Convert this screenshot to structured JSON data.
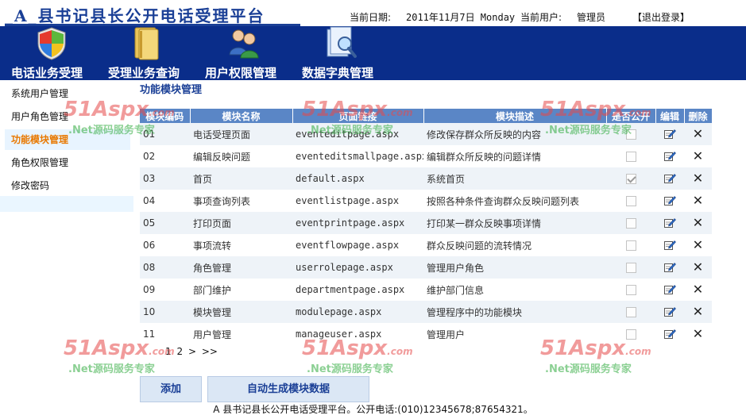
{
  "header": {
    "app_title": "_A_县书记县长公开电话受理平台",
    "date_label": "当前日期:",
    "date_value": "2011年11月7日 Monday",
    "user_label": "当前用户:",
    "user_value": "管理员",
    "logout_label": "【退出登录】"
  },
  "menu": [
    {
      "label": "电话业务受理",
      "icon": "shield-icon"
    },
    {
      "label": "受理业务查询",
      "icon": "folder-icon"
    },
    {
      "label": "用户权限管理",
      "icon": "users-icon"
    },
    {
      "label": "数据字典管理",
      "icon": "search-document-icon"
    }
  ],
  "sidebar": {
    "items": [
      {
        "label": "系统用户管理",
        "active": false
      },
      {
        "label": "用户角色管理",
        "active": false
      },
      {
        "label": "功能模块管理",
        "active": true
      },
      {
        "label": "角色权限管理",
        "active": false
      },
      {
        "label": "修改密码",
        "active": false
      }
    ]
  },
  "main": {
    "title": "功能模块管理",
    "columns": [
      "模块编码",
      "模块名称",
      "页面链接",
      "模块描述",
      "是否公开",
      "编辑",
      "删除"
    ],
    "rows": [
      {
        "code": "01",
        "name": "电话受理页面",
        "page": "eventeditpage.aspx",
        "desc": "修改保存群众所反映的内容",
        "public": false
      },
      {
        "code": "02",
        "name": "编辑反映问题",
        "page": "eventeditsmallpage.aspx",
        "desc": "编辑群众所反映的问题详情",
        "public": false
      },
      {
        "code": "03",
        "name": "首页",
        "page": "default.aspx",
        "desc": "系统首页",
        "public": true
      },
      {
        "code": "04",
        "name": "事项查询列表",
        "page": "eventlistpage.aspx",
        "desc": "按照各种条件查询群众反映问题列表",
        "public": false
      },
      {
        "code": "05",
        "name": "打印页面",
        "page": "eventprintpage.aspx",
        "desc": "打印某一群众反映事项详情",
        "public": false
      },
      {
        "code": "06",
        "name": "事项流转",
        "page": "eventflowpage.aspx",
        "desc": "群众反映问题的流转情况",
        "public": false
      },
      {
        "code": "08",
        "name": "角色管理",
        "page": "userrolepage.aspx",
        "desc": "管理用户角色",
        "public": false
      },
      {
        "code": "09",
        "name": "部门维护",
        "page": "departmentpage.aspx",
        "desc": "维护部门信息",
        "public": false
      },
      {
        "code": "10",
        "name": "模块管理",
        "page": "modulepage.aspx",
        "desc": "管理程序中的功能模块",
        "public": false
      },
      {
        "code": "11",
        "name": "用户管理",
        "page": "manageuser.aspx",
        "desc": "管理用户",
        "public": false
      }
    ],
    "edit_icon": "edit-icon",
    "delete_icon": "delete-x-icon",
    "pager": [
      "1",
      "2",
      ">",
      ">>"
    ],
    "add_button": "添加",
    "generate_button": "自动生成模块数据"
  },
  "footer": {
    "text": "A 县书记县长公开电话受理平台。公开电话:(010)12345678;87654321。"
  },
  "watermark": {
    "brand": "51Aspx",
    "domain": ".com",
    "slogan": ".Net源码服务专家"
  },
  "colors": {
    "title_blue": "#1a3f96",
    "menubar_navy": "#0a2d8a",
    "grid_header": "#5a86c6",
    "active_orange": "#e87800",
    "watermark_red": "#e64a4a",
    "watermark_green": "#3fb14d"
  }
}
